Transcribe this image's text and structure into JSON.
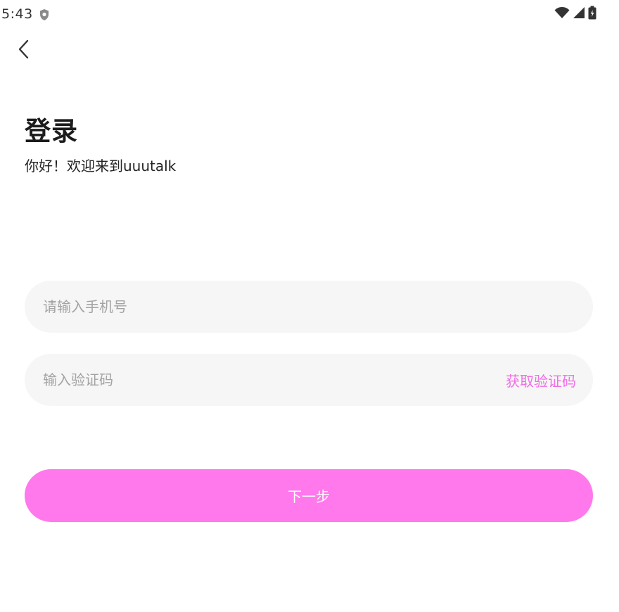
{
  "status_bar": {
    "time": "5:43",
    "icons": [
      "shield-icon",
      "wifi-icon",
      "cellular-signal-icon",
      "battery-icon"
    ]
  },
  "header": {
    "back_icon": "chevron-left-icon"
  },
  "login": {
    "title": "登录",
    "subtitle": "你好！欢迎来到uuutalk",
    "phone_input": {
      "value": "",
      "placeholder": "请输入手机号"
    },
    "code_input": {
      "value": "",
      "placeholder": "输入验证码"
    },
    "get_code_label": "获取验证码",
    "next_label": "下一步"
  },
  "colors": {
    "accent": "#ff78ec",
    "accent_text": "#f06ee6",
    "field_background": "#f6f6f6",
    "placeholder": "#a3a3a3"
  }
}
